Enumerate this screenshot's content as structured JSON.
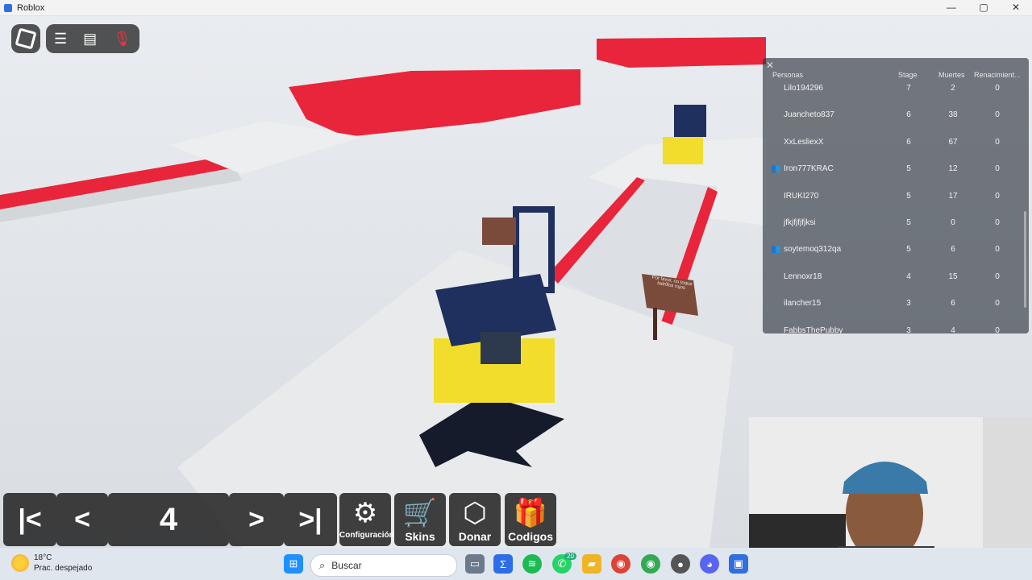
{
  "window": {
    "title": "Roblox",
    "controls": [
      "—",
      "▢",
      "✕"
    ]
  },
  "hud": {
    "icons": [
      "roblox-menu-icon",
      "hamburger-icon",
      "chat-icon",
      "microphone-icon"
    ]
  },
  "leaderboard": {
    "close_glyph": "✕",
    "headers": {
      "personas": "Personas",
      "stage": "Stage",
      "muertes": "Muertes",
      "renacimiento": "Renacimient..."
    },
    "rows": [
      {
        "name": "Lilo194296",
        "stage": "7",
        "muertes": "2",
        "renac": "0",
        "friend": false
      },
      {
        "name": "Juancheto837",
        "stage": "6",
        "muertes": "38",
        "renac": "0",
        "friend": false
      },
      {
        "name": "XxLesliexX",
        "stage": "6",
        "muertes": "67",
        "renac": "0",
        "friend": false
      },
      {
        "name": "Iron777KRAC",
        "stage": "5",
        "muertes": "12",
        "renac": "0",
        "friend": true
      },
      {
        "name": "IRUKI270",
        "stage": "5",
        "muertes": "17",
        "renac": "0",
        "friend": false
      },
      {
        "name": "jfkjfjfjfjksi",
        "stage": "5",
        "muertes": "0",
        "renac": "0",
        "friend": false
      },
      {
        "name": "soytemoq312qa",
        "stage": "5",
        "muertes": "6",
        "renac": "0",
        "friend": true
      },
      {
        "name": "Lennoxr18",
        "stage": "4",
        "muertes": "15",
        "renac": "0",
        "friend": false
      },
      {
        "name": "ilancher15",
        "stage": "3",
        "muertes": "6",
        "renac": "0",
        "friend": false
      },
      {
        "name": "FabbsThePubby",
        "stage": "3",
        "muertes": "4",
        "renac": "0",
        "friend": false
      }
    ]
  },
  "stage_nav": {
    "first": "|<",
    "prev": "<",
    "current": "4",
    "next": ">",
    "last": ">|"
  },
  "toolbar": {
    "config": "Configuración",
    "skins": "Skins",
    "donar": "Donar",
    "codigos": "Codigos"
  },
  "sign_text": "Por favor, no toque ladrillos rojos",
  "taskbar": {
    "temp": "18°C",
    "weather": "Prac. despejado",
    "search": "Buscar",
    "badge": "20"
  },
  "colors": {
    "red": "#e8253a",
    "yellow": "#f2dd2c",
    "navy": "#1f2f5e",
    "floor": "#e6e8ea"
  }
}
